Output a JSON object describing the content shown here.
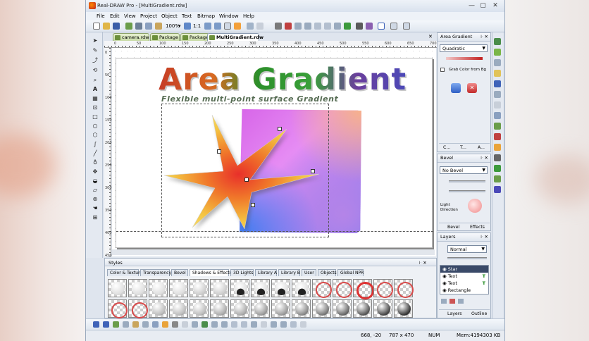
{
  "window": {
    "title": "Real-DRAW Pro - [MultiGradient.rdw]",
    "min": "—",
    "max": "▢",
    "close": "✕"
  },
  "menu": [
    "File",
    "Edit",
    "View",
    "Project",
    "Object",
    "Text",
    "Bitmap",
    "Window",
    "Help"
  ],
  "toolbar": {
    "zoom": "100%",
    "ratio": "1:1"
  },
  "doc_tabs": [
    "camera.rdw",
    "Package",
    "Package",
    "MultiGradient.rdw"
  ],
  "ruler_h": [
    "0",
    "50",
    "100",
    "150",
    "200",
    "250",
    "300",
    "350",
    "400",
    "450",
    "500",
    "550",
    "600",
    "650",
    "700"
  ],
  "ruler_v": [
    "0",
    "50",
    "100",
    "150",
    "200",
    "250",
    "300",
    "350",
    "400",
    "450"
  ],
  "canvas": {
    "heading": "Area Gradient",
    "subheading": "Flexible multi-point surface Gradient"
  },
  "area_gradient_panel": {
    "title": "Area Gradient",
    "pin": "꜏ ✕",
    "type": "Quadratic",
    "checkbox_label": "Grab Color from Bg",
    "tabs": [
      "C...",
      "T...",
      "A..."
    ]
  },
  "bevel_panel": {
    "title": "Bevel",
    "pin": "꜏ ✕",
    "type": "No Bevel",
    "light_label_1": "Light",
    "light_label_2": "Direction",
    "tabs": [
      "Bevel",
      "Effects"
    ]
  },
  "layers_panel": {
    "title": "Layers",
    "pin": "꜏ ✕",
    "blend": "Normal",
    "layers": [
      {
        "name": "Star",
        "flag": ""
      },
      {
        "name": "Text",
        "flag": "T"
      },
      {
        "name": "Text",
        "flag": "T"
      },
      {
        "name": "Rectangle",
        "flag": ""
      }
    ],
    "tabs": [
      "Layers",
      "Outline"
    ]
  },
  "styles_panel": {
    "title": "Styles",
    "pin": "꜏ ✕",
    "tabs": [
      "Color & Texture",
      "Transparency",
      "Bevel",
      "Shadows & Effects",
      "3D Lights",
      "Library A",
      "Library B",
      "User",
      "Objects",
      "Global NPR"
    ],
    "active_tab": "Shadows & Effects"
  },
  "status": {
    "coords": "668, -20",
    "size": "787 x 470",
    "num": "NUM",
    "memory": "Mem:4194303 KB"
  },
  "colors": {
    "accent": "#3f63b8",
    "window_bg": "#dfe5ee",
    "selection": "#3a4a68"
  }
}
